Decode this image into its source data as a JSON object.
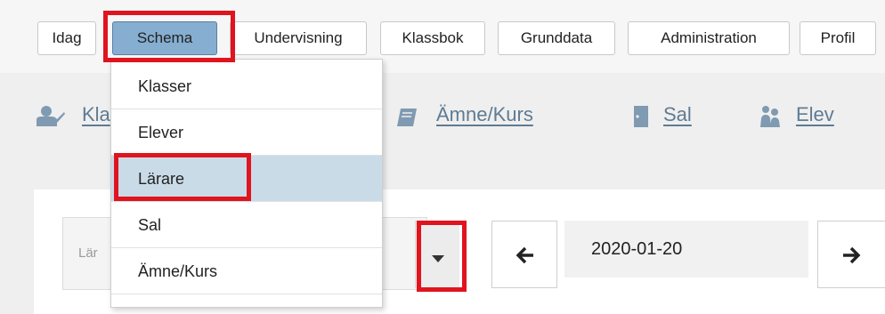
{
  "nav": {
    "tabs": [
      {
        "label": "Idag"
      },
      {
        "label": "Schema"
      },
      {
        "label": "Undervisning"
      },
      {
        "label": "Klassbok"
      },
      {
        "label": "Grunddata"
      },
      {
        "label": "Administration"
      },
      {
        "label": "Profil"
      }
    ],
    "active": "Schema"
  },
  "sublinks": [
    {
      "label": "Kla",
      "icon": "teacher-icon"
    },
    {
      "label": "Ämne/Kurs",
      "icon": "book-icon"
    },
    {
      "label": "Sal",
      "icon": "door-icon"
    },
    {
      "label": "Elev",
      "icon": "students-icon"
    }
  ],
  "dropdown": {
    "items": [
      {
        "label": "Klasser"
      },
      {
        "label": "Elever"
      },
      {
        "label": "Lärare"
      },
      {
        "label": "Sal"
      },
      {
        "label": "Ämne/Kurs"
      }
    ],
    "selected": "Lärare"
  },
  "controls": {
    "select_placeholder": "Lär",
    "date": "2020-01-20",
    "prev_icon": "arrow-left-icon",
    "next_icon": "arrow-right-icon",
    "caret_icon": "caret-down-icon"
  },
  "colors": {
    "active_tab": "#86aed0",
    "highlight": "#e0141e",
    "link": "#5f7b93",
    "selected_item": "#cadbe8"
  }
}
